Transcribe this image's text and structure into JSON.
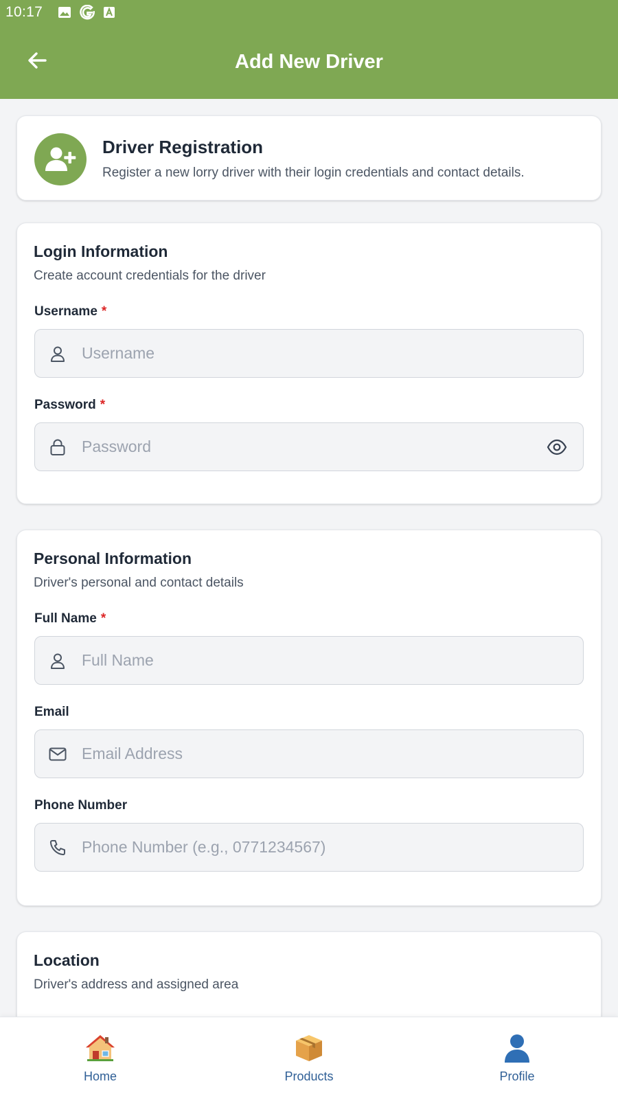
{
  "status_bar": {
    "time": "10:17",
    "icons": [
      "image-icon",
      "google-icon",
      "a-box-icon"
    ]
  },
  "header": {
    "title": "Add New Driver",
    "back_icon": "arrow-left-icon"
  },
  "registration": {
    "title": "Driver Registration",
    "subtitle": "Register a new lorry driver with their login credentials and contact details.",
    "icon": "user-plus-icon"
  },
  "login_section": {
    "title": "Login Information",
    "subtitle": "Create account credentials for the driver",
    "username": {
      "label": "Username",
      "required_mark": "*",
      "placeholder": "Username",
      "value": ""
    },
    "password": {
      "label": "Password",
      "required_mark": "*",
      "placeholder": "Password",
      "value": ""
    }
  },
  "personal_section": {
    "title": "Personal Information",
    "subtitle": "Driver's personal and contact details",
    "full_name": {
      "label": "Full Name",
      "required_mark": "*",
      "placeholder": "Full Name",
      "value": ""
    },
    "email": {
      "label": "Email",
      "placeholder": "Email Address",
      "value": ""
    },
    "phone": {
      "label": "Phone Number",
      "placeholder": "Phone Number (e.g., 0771234567)",
      "value": ""
    }
  },
  "location_section": {
    "title": "Location",
    "subtitle": "Driver's address and assigned area"
  },
  "bottom_nav": {
    "items": [
      {
        "label": "Home",
        "icon": "house-icon"
      },
      {
        "label": "Products",
        "icon": "package-icon"
      },
      {
        "label": "Profile",
        "icon": "person-icon"
      }
    ]
  },
  "colors": {
    "primary": "#7fa853",
    "nav_text": "#2f5f96",
    "required": "#dc2626",
    "background": "#f3f4f6"
  }
}
